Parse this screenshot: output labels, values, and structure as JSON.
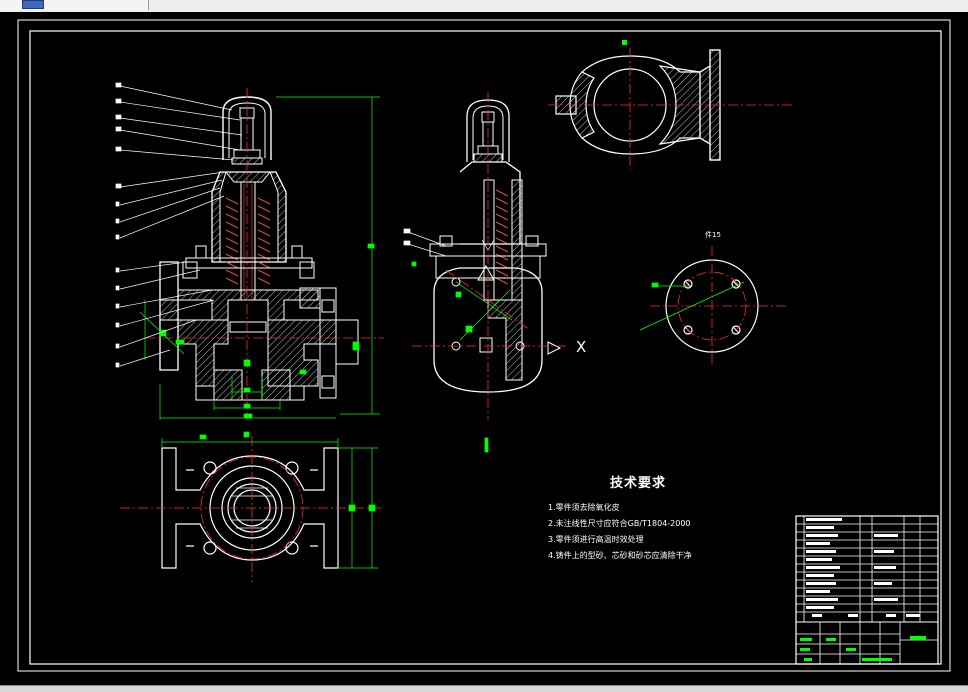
{
  "drawing": {
    "background": "#000000",
    "colors": {
      "outline": "#ffffff",
      "dimension": "#00ff00",
      "centerline": "#ff2a2a",
      "hatch": "#dcdcdc",
      "spring": "#e04a4a",
      "leader": "#ffffff",
      "title_block": "#ffffff"
    },
    "tech_requirements": {
      "title": "技术要求",
      "items": [
        "1.零件须去除氧化皮",
        "2.未注线性尺寸应符合GB/T1804-2000",
        "3.零件须进行高温时效处理",
        "4.铸件上的型砂、芯砂和砂芯应清除干净"
      ]
    },
    "section_label": "件15",
    "axis_marker": "X"
  }
}
